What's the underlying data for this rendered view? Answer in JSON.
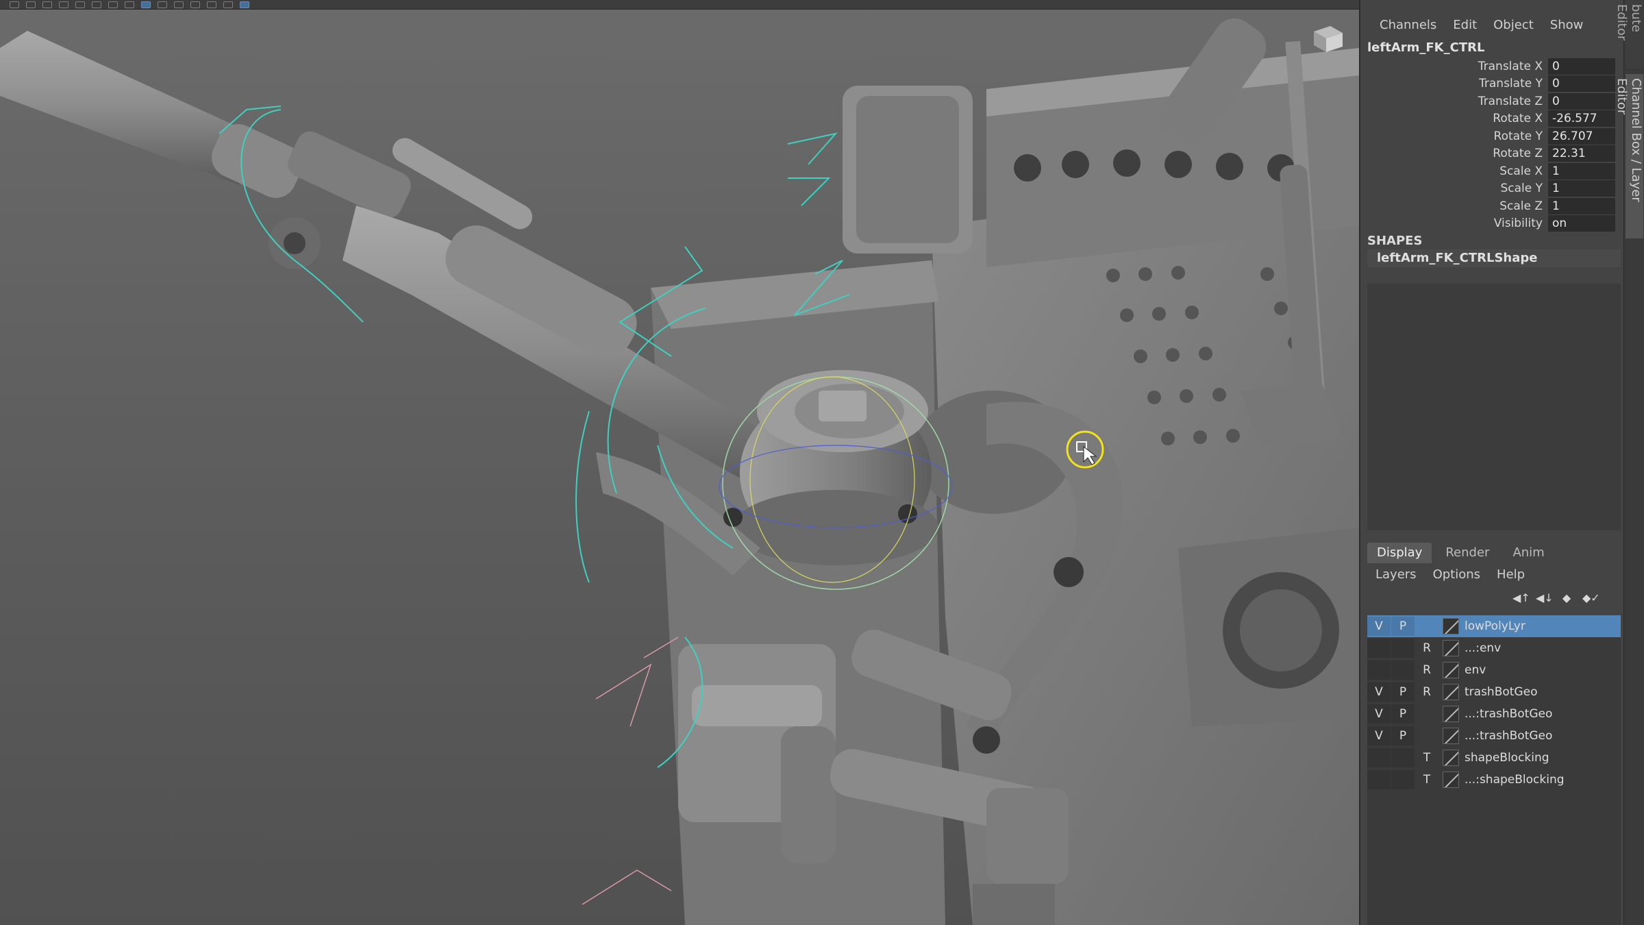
{
  "side_tabs": [
    "bute Editor",
    "Channel Box / Layer Editor"
  ],
  "channel_box": {
    "menu": [
      "Channels",
      "Edit",
      "Object",
      "Show"
    ],
    "node_name": "leftArm_FK_CTRL",
    "attributes": [
      {
        "label": "Translate X",
        "value": "0"
      },
      {
        "label": "Translate Y",
        "value": "0"
      },
      {
        "label": "Translate Z",
        "value": "0"
      },
      {
        "label": "Rotate X",
        "value": "-26.577"
      },
      {
        "label": "Rotate Y",
        "value": "26.707"
      },
      {
        "label": "Rotate Z",
        "value": "22.31"
      },
      {
        "label": "Scale X",
        "value": "1"
      },
      {
        "label": "Scale Y",
        "value": "1"
      },
      {
        "label": "Scale Z",
        "value": "1"
      },
      {
        "label": "Visibility",
        "value": "on"
      }
    ],
    "shapes_header": "SHAPES",
    "shape_name": "leftArm_FK_CTRLShape"
  },
  "layer_editor": {
    "tabs": [
      "Display",
      "Render",
      "Anim"
    ],
    "active_tab": "Display",
    "menu": [
      "Layers",
      "Options",
      "Help"
    ],
    "tool_icons": [
      "move-layer-up-icon",
      "move-layer-down-icon",
      "new-layer-icon",
      "new-layer-from-selection-icon"
    ],
    "layers": [
      {
        "v": "V",
        "p": "P",
        "r": "",
        "name": "lowPolyLyr",
        "selected": true
      },
      {
        "v": "",
        "p": "",
        "r": "R",
        "name": "...:env",
        "selected": false
      },
      {
        "v": "",
        "p": "",
        "r": "R",
        "name": "env",
        "selected": false
      },
      {
        "v": "V",
        "p": "P",
        "r": "R",
        "name": "trashBotGeo",
        "selected": false
      },
      {
        "v": "V",
        "p": "P",
        "r": "",
        "name": "...:trashBotGeo",
        "selected": false
      },
      {
        "v": "V",
        "p": "P",
        "r": "",
        "name": "...:trashBotGeo",
        "selected": false
      },
      {
        "v": "",
        "p": "",
        "r": "T",
        "name": "shapeBlocking",
        "selected": false
      },
      {
        "v": "",
        "p": "",
        "r": "T",
        "name": "...:shapeBlocking",
        "selected": false
      }
    ]
  },
  "colors": {
    "selection": "#5285b9",
    "viewport_bg": "#5e5e5e",
    "control_curve": "#3fd0c0",
    "cursor_ring": "#f2e21a"
  }
}
